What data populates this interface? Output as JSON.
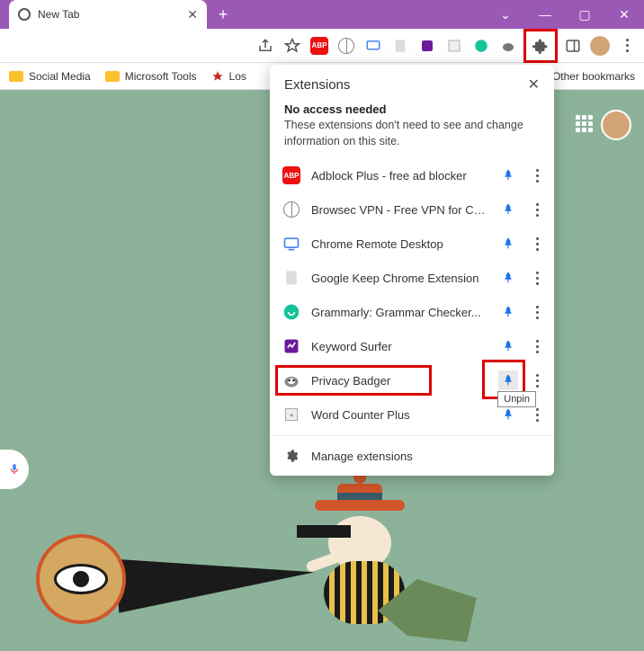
{
  "titlebar": {
    "tab_title": "New Tab",
    "window_buttons": {
      "min": "—",
      "max": "▢",
      "close": "✕"
    }
  },
  "bookmarks": {
    "items": [
      {
        "label": "Social Media"
      },
      {
        "label": "Microsoft Tools"
      },
      {
        "label": "Los"
      }
    ],
    "overflow": "Other bookmarks"
  },
  "extensions_popup": {
    "title": "Extensions",
    "close": "✕",
    "section_heading": "No access needed",
    "section_desc": "These extensions don't need to see and change information on this site.",
    "items": [
      {
        "name": "Adblock Plus - free ad blocker",
        "icon": "abp"
      },
      {
        "name": "Browsec VPN - Free VPN for Ch...",
        "icon": "globe"
      },
      {
        "name": "Chrome Remote Desktop",
        "icon": "crd"
      },
      {
        "name": "Google Keep Chrome Extension",
        "icon": "keep"
      },
      {
        "name": "Grammarly: Grammar Checker...",
        "icon": "grammarly"
      },
      {
        "name": "Keyword Surfer",
        "icon": "surfer"
      },
      {
        "name": "Privacy Badger",
        "icon": "badger"
      },
      {
        "name": "Word Counter Plus",
        "icon": "wcp"
      }
    ],
    "manage": "Manage extensions",
    "tooltip": "Unpin"
  }
}
